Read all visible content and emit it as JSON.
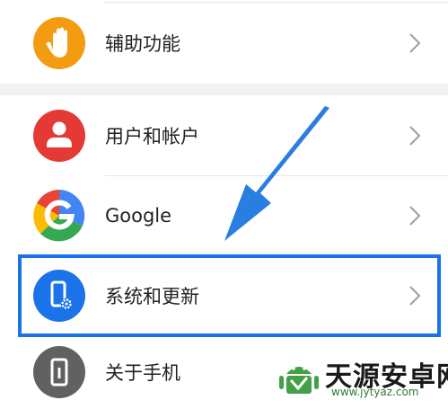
{
  "settings": {
    "items": [
      {
        "label": "辅助功能",
        "icon": "hand-icon",
        "color": "#f39c12"
      },
      {
        "label": "用户和帐户",
        "icon": "user-icon",
        "color": "#e53935"
      },
      {
        "label": "Google",
        "icon": "google-icon",
        "color": "#ffffff"
      },
      {
        "label": "系统和更新",
        "icon": "phone-settings-icon",
        "color": "#1a73e8"
      },
      {
        "label": "关于手机",
        "icon": "phone-info-icon",
        "color": "#616161"
      }
    ],
    "highlight_color": "#1a73e8",
    "arrow_color": "#2a7de1"
  },
  "watermark": {
    "text": "天源安卓网",
    "url": "www.jytyaz.com"
  }
}
